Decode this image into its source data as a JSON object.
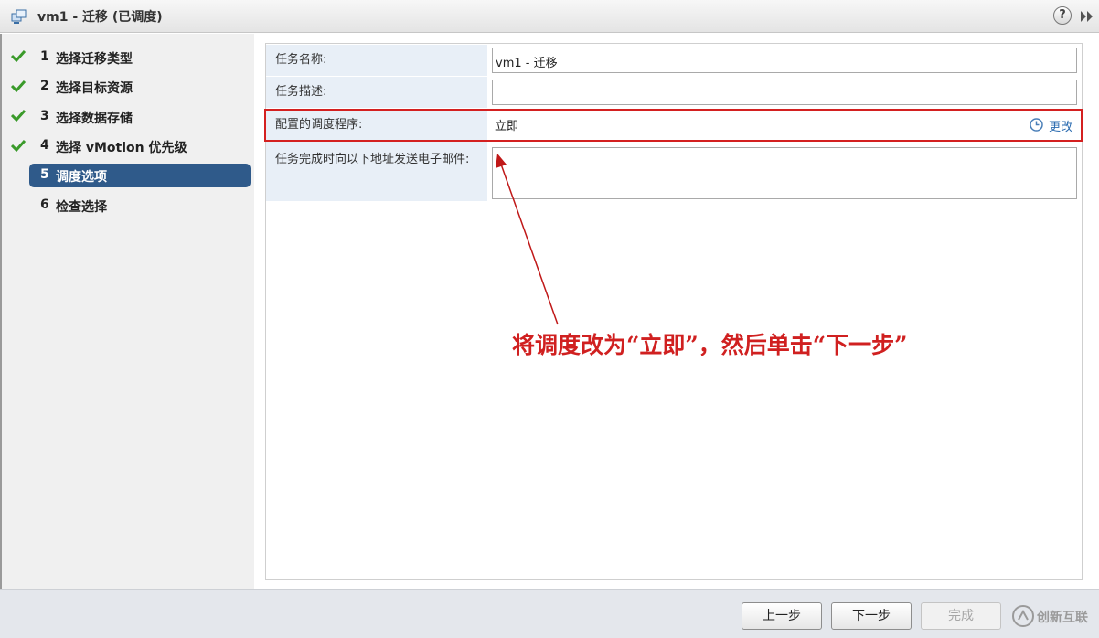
{
  "window": {
    "title": "vm1 - 迁移 (已调度)",
    "help_symbol": "?"
  },
  "steps": [
    {
      "number": "1",
      "label": "选择迁移类型",
      "completed": true
    },
    {
      "number": "2",
      "label": "选择目标资源",
      "completed": true
    },
    {
      "number": "3",
      "label": "选择数据存储",
      "completed": true
    },
    {
      "number": "4",
      "label": "选择 vMotion 优先级",
      "completed": true
    },
    {
      "number": "5",
      "label": "调度选项",
      "active": true
    },
    {
      "number": "6",
      "label": "检查选择",
      "completed": false
    }
  ],
  "form": {
    "task_name_label": "任务名称:",
    "task_name_value": "vm1 - 迁移",
    "task_desc_label": "任务描述:",
    "task_desc_value": "",
    "schedule_label": "配置的调度程序:",
    "schedule_value": "立即",
    "change_link": "更改",
    "email_label": "任务完成时向以下地址发送电子邮件:",
    "email_value": ""
  },
  "annotation": {
    "text": "将调度改为“立即”，然后单击“下一步”",
    "color": "#d02020"
  },
  "footer": {
    "back_label": "上一步",
    "next_label": "下一步",
    "finish_label": "完成"
  },
  "watermark": {
    "text": "创新互联"
  },
  "colors": {
    "active_step": "#2f5a8a",
    "check": "#3a9a2a",
    "link": "#2a6bb0",
    "highlight": "#d42020"
  }
}
